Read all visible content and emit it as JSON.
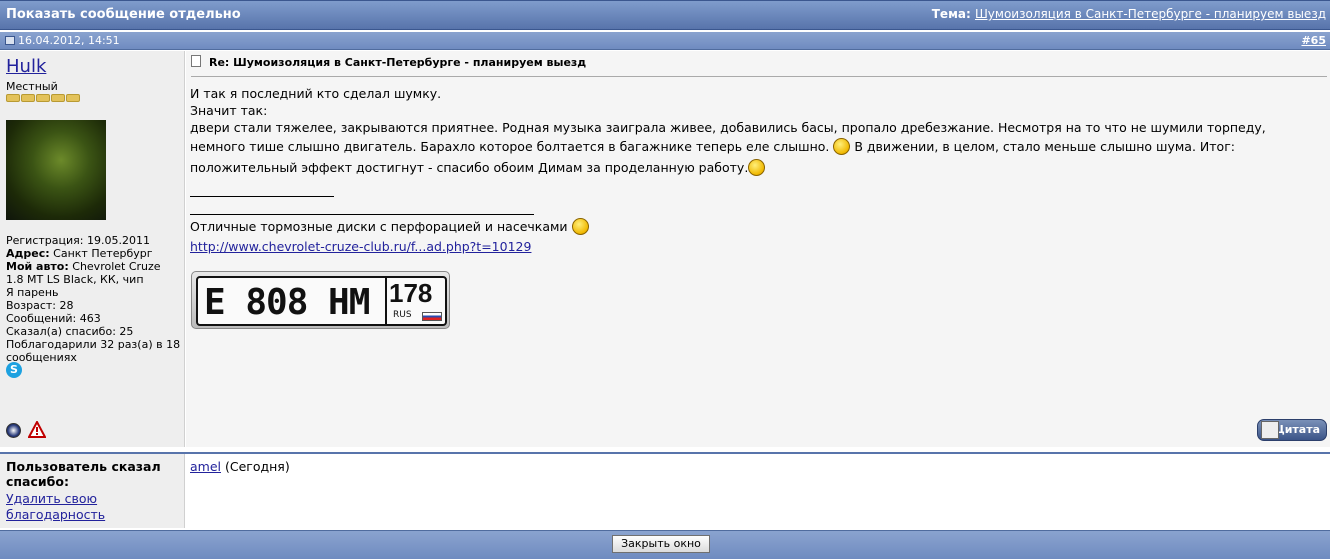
{
  "titlebar": {
    "title": "Показать сообщение отдельно",
    "topic_label": "Тема:",
    "topic_link": "Шумоизоляция в Санкт-Петербурге - планируем выезд"
  },
  "post": {
    "date": "16.04.2012, 14:51",
    "number": "#65",
    "title": "Re: Шумоизоляция в Санкт-Петербурге - планируем выезд",
    "body": {
      "line1": "И так я последний кто сделал шумку.",
      "line2": "Значит так:",
      "line3": "двери стали тяжелее, закрываются приятнее. Родная музыка заиграла живее, добавились басы, пропало дребезжание. Несмотря на то что не шумили торпеду,",
      "line4a": "немного тише слышно двигатель. Барахло которое болтается в багажнике теперь еле слышно.",
      "line4b": "В движении, в целом, стало меньше слышно шума. Итог:",
      "line5": "положительный эффект достигнут - спасибо обоим Димам за проделанную работу."
    },
    "signature": {
      "text": "Отличные тормозные диски с перфорацией и насечками",
      "link": "http://www.chevrolet-cruze-club.ru/f...ad.php?t=10129",
      "plate_number": "E 808 HM",
      "plate_region": "178",
      "plate_country": "RUS"
    },
    "quote_button": "Цитата"
  },
  "user": {
    "name": "Hulk",
    "title": "Местный",
    "stars": 5,
    "registration": "Регистрация: 19.05.2011",
    "address_label": "Адрес:",
    "address_value": " Санкт Петербург",
    "car_label": "Мой авто:",
    "car_value": " Chevrolet Cruze 1.8 MT LS Black, КК, чип",
    "gender": "Я парень",
    "age": "Возраст: 28",
    "posts": "Сообщений: 463",
    "thanked": "Сказал(а) спасибо: 25",
    "thanks_received": "Поблагодарили 32 раз(а) в 18 сообщениях"
  },
  "thanks": {
    "title": "Пользователь сказал спасибо:",
    "remove": "Удалить свою благодарность",
    "user": "amel",
    "when": " (Сегодня)"
  },
  "footer": {
    "close_button": "Закрыть окно"
  }
}
